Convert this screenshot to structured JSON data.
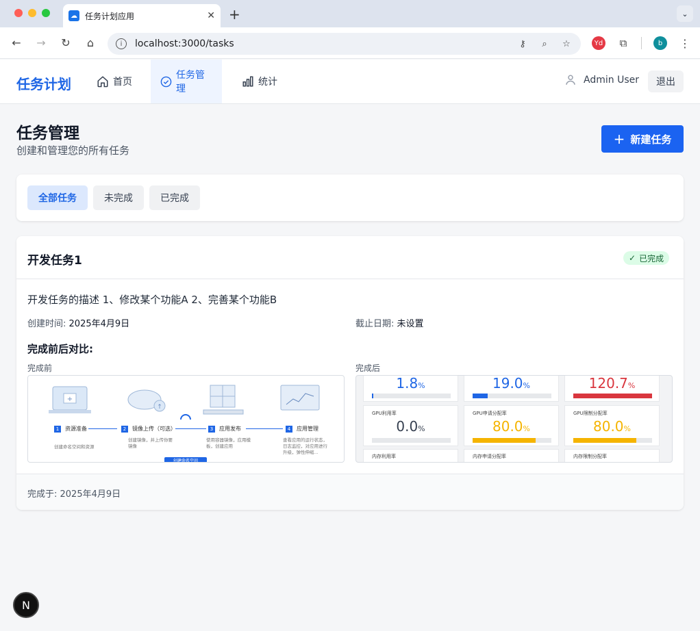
{
  "browser": {
    "tab_title": "任务计划应用",
    "tab_favicon": "cloud-icon",
    "url": "localhost:3000/tasks",
    "extension_yd": "Yd",
    "profile_initial": "b"
  },
  "header": {
    "brand": "任务计划",
    "nav": [
      {
        "label": "首页",
        "icon": "home-icon"
      },
      {
        "label": "任务管理",
        "icon": "check-circle-icon",
        "active": true
      },
      {
        "label": "统计",
        "icon": "bar-chart-icon"
      }
    ],
    "user_name": "Admin User",
    "logout_label": "退出"
  },
  "page": {
    "title": "任务管理",
    "subtitle": "创建和管理您的所有任务",
    "new_task_label": "新建任务"
  },
  "filters": [
    {
      "label": "全部任务",
      "active": true
    },
    {
      "label": "未完成",
      "active": false
    },
    {
      "label": "已完成",
      "active": false
    }
  ],
  "task": {
    "title": "开发任务1",
    "status": "已完成",
    "description": "开发任务的描述 1、修改某个功能A 2、完善某个功能B",
    "created_label": "创建时间:",
    "created_value": "2025年4月9日",
    "due_label": "截止日期:",
    "due_value": "未设置",
    "compare_title": "完成前后对比:",
    "before_label": "完成前",
    "after_label": "完成后",
    "completed_at": "完成于: 2025年4月9日"
  },
  "before_image": {
    "steps": [
      {
        "num": "1",
        "label": "资源准备",
        "desc": "创建命名空间和资源"
      },
      {
        "num": "2",
        "label": "镜像上传（可选）",
        "desc": "创建镜像，并上传你要镜像"
      },
      {
        "num": "3",
        "label": "应用发布",
        "desc": "使用容器镜像，应用模板，创建应用"
      },
      {
        "num": "4",
        "label": "应用管理",
        "desc": "查看应用的运行状态，日志监控，对应用进行升级，弹性伸缩..."
      }
    ],
    "button": "创建命名空间"
  },
  "after_image": {
    "metrics_row1": [
      {
        "value": "1.8",
        "unit": "%",
        "fill": 0.018,
        "color": "#1f66e5"
      },
      {
        "value": "19.0",
        "unit": "%",
        "fill": 0.19,
        "color": "#1f66e5"
      },
      {
        "value": "120.7",
        "unit": "%",
        "fill": 1.0,
        "color": "#d9363e"
      }
    ],
    "metrics_row2": [
      {
        "label": "GPU利用率",
        "value": "0.0",
        "unit": "%",
        "fill": 0.0,
        "color": "#1f66e5"
      },
      {
        "label": "GPU申请分配率",
        "value": "80.0",
        "unit": "%",
        "fill": 0.8,
        "color": "#f5b400"
      },
      {
        "label": "GPU限制分配率",
        "value": "80.0",
        "unit": "%",
        "fill": 0.8,
        "color": "#f5b400"
      }
    ],
    "metrics_row3_labels": [
      "内存利用率",
      "内存申请分配率",
      "内存限制分配率"
    ]
  },
  "fab_label": "N"
}
